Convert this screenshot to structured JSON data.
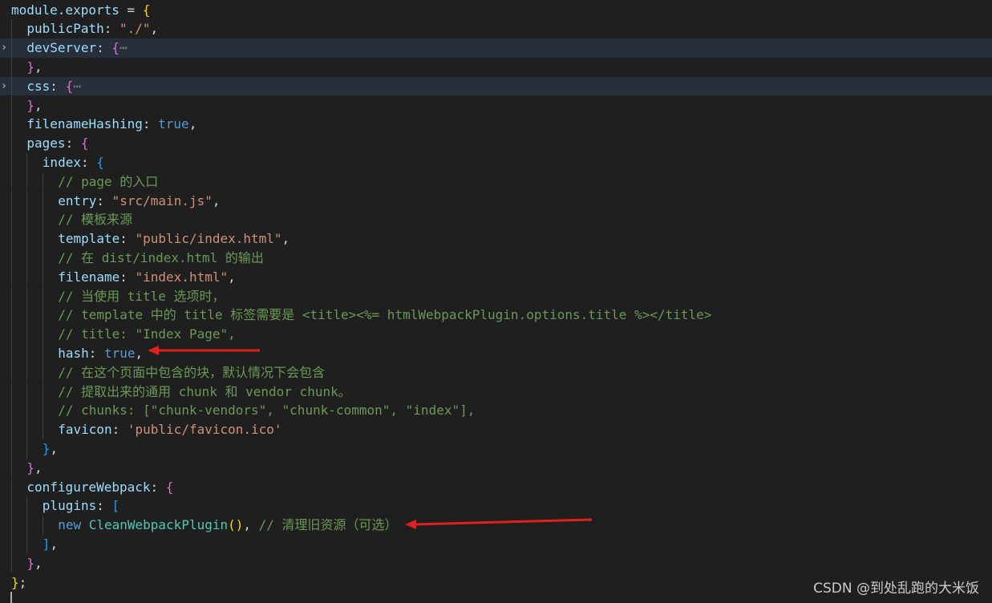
{
  "lines": [
    {
      "tokens": [
        [
          "prop",
          "module.exports"
        ],
        [
          "plain",
          " = "
        ],
        [
          "br1",
          "{"
        ]
      ]
    },
    {
      "tokens": [
        [
          "prop",
          "publicPath"
        ],
        [
          "plain",
          ": "
        ],
        [
          "str",
          "\"./\""
        ],
        [
          "plain",
          ","
        ]
      ]
    },
    {
      "tokens": [
        [
          "prop",
          "devServer"
        ],
        [
          "plain",
          ": "
        ],
        [
          "br2",
          "{"
        ],
        [
          "ell",
          "⋯"
        ]
      ],
      "folded": true
    },
    {
      "tokens": [
        [
          "br2",
          "}"
        ],
        [
          "plain",
          ","
        ]
      ]
    },
    {
      "tokens": [
        [
          "prop",
          "css"
        ],
        [
          "plain",
          ": "
        ],
        [
          "br2",
          "{"
        ],
        [
          "ell",
          "⋯"
        ]
      ],
      "folded": true
    },
    {
      "tokens": [
        [
          "br2",
          "}"
        ],
        [
          "plain",
          ","
        ]
      ]
    },
    {
      "tokens": [
        [
          "prop",
          "filenameHashing"
        ],
        [
          "plain",
          ": "
        ],
        [
          "bool",
          "true"
        ],
        [
          "plain",
          ","
        ]
      ]
    },
    {
      "tokens": [
        [
          "prop",
          "pages"
        ],
        [
          "plain",
          ": "
        ],
        [
          "br2",
          "{"
        ]
      ]
    },
    {
      "tokens": [
        [
          "prop",
          "index"
        ],
        [
          "plain",
          ": "
        ],
        [
          "br3",
          "{"
        ]
      ]
    },
    {
      "tokens": [
        [
          "cmt",
          "// page 的入口"
        ]
      ]
    },
    {
      "tokens": [
        [
          "prop",
          "entry"
        ],
        [
          "plain",
          ": "
        ],
        [
          "str",
          "\"src/main.js\""
        ],
        [
          "plain",
          ","
        ]
      ]
    },
    {
      "tokens": [
        [
          "cmt",
          "// 模板来源"
        ]
      ]
    },
    {
      "tokens": [
        [
          "prop",
          "template"
        ],
        [
          "plain",
          ": "
        ],
        [
          "str",
          "\"public/index.html\""
        ],
        [
          "plain",
          ","
        ]
      ]
    },
    {
      "tokens": [
        [
          "cmt",
          "// 在 dist/index.html 的输出"
        ]
      ]
    },
    {
      "tokens": [
        [
          "prop",
          "filename"
        ],
        [
          "plain",
          ": "
        ],
        [
          "str",
          "\"index.html\""
        ],
        [
          "plain",
          ","
        ]
      ]
    },
    {
      "tokens": [
        [
          "cmt",
          "// 当使用 title 选项时，"
        ]
      ]
    },
    {
      "tokens": [
        [
          "cmt",
          "// template 中的 title 标签需要是 <title><%= htmlWebpackPlugin.options.title %></title>"
        ]
      ]
    },
    {
      "tokens": [
        [
          "cmt",
          "// title: \"Index Page\","
        ]
      ]
    },
    {
      "tokens": [
        [
          "prop",
          "hash"
        ],
        [
          "plain",
          ": "
        ],
        [
          "bool",
          "true"
        ],
        [
          "plain",
          ","
        ]
      ]
    },
    {
      "tokens": [
        [
          "cmt",
          "// 在这个页面中包含的块，默认情况下会包含"
        ]
      ]
    },
    {
      "tokens": [
        [
          "cmt",
          "// 提取出来的通用 chunk 和 vendor chunk。"
        ]
      ]
    },
    {
      "tokens": [
        [
          "cmt",
          "// chunks: [\"chunk-vendors\", \"chunk-common\", \"index\"],"
        ]
      ]
    },
    {
      "tokens": [
        [
          "prop",
          "favicon"
        ],
        [
          "plain",
          ": "
        ],
        [
          "str",
          "'public/favicon.ico'"
        ]
      ]
    },
    {
      "tokens": [
        [
          "br3",
          "}"
        ],
        [
          "plain",
          ","
        ]
      ]
    },
    {
      "tokens": [
        [
          "br2",
          "}"
        ],
        [
          "plain",
          ","
        ]
      ]
    },
    {
      "tokens": [
        [
          "prop",
          "configureWebpack"
        ],
        [
          "plain",
          ": "
        ],
        [
          "br2",
          "{"
        ]
      ]
    },
    {
      "tokens": [
        [
          "prop",
          "plugins"
        ],
        [
          "plain",
          ": "
        ],
        [
          "br3",
          "["
        ]
      ]
    },
    {
      "tokens": [
        [
          "bool",
          "new "
        ],
        [
          "fn",
          "CleanWebpackPlugin"
        ],
        [
          "br1",
          "()"
        ],
        [
          "plain",
          ", "
        ],
        [
          "cmt",
          "// 清理旧资源（可选）"
        ]
      ]
    },
    {
      "tokens": [
        [
          "br3",
          "]"
        ],
        [
          "plain",
          ","
        ]
      ]
    },
    {
      "tokens": [
        [
          "br2",
          "}"
        ],
        [
          "plain",
          ","
        ]
      ]
    },
    {
      "tokens": [
        [
          "br1",
          "}"
        ],
        [
          "plain",
          ";"
        ]
      ]
    }
  ],
  "watermark": "CSDN @到处乱跑的大米饭",
  "colors": {
    "background": "#1f1f1f",
    "highlight": "#262f3a",
    "arrow": "#e0201c"
  }
}
